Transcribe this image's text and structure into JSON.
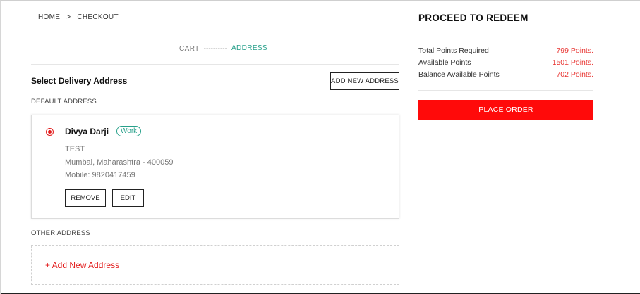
{
  "breadcrumb": {
    "home": "HOME",
    "separator": ">",
    "current": "CHECKOUT"
  },
  "steps": {
    "cart": "CART",
    "dashes": "----------",
    "address": "ADDRESS"
  },
  "address_section": {
    "title": "Select Delivery Address",
    "add_button": "ADD NEW ADDRESS",
    "default_label": "DEFAULT ADDRESS",
    "other_label": "OTHER ADDRESS",
    "add_link": "+ Add New Address"
  },
  "default_address": {
    "selected": true,
    "name": "Divya Darji",
    "tag": "Work",
    "line1": "TEST",
    "line2": "Mumbai, Maharashtra - 400059",
    "mobile": "Mobile: 9820417459",
    "remove_label": "REMOVE",
    "edit_label": "EDIT"
  },
  "summary": {
    "title": "PROCEED TO REDEEM",
    "rows": [
      {
        "label": "Total Points Required",
        "value": "799 Points."
      },
      {
        "label": "Available Points",
        "value": "1501 Points."
      },
      {
        "label": "Balance Available Points",
        "value": "702 Points."
      }
    ],
    "place_order": "PLACE ORDER"
  },
  "colors": {
    "accent_red": "#ff0a0a",
    "points_red": "#e8322f",
    "teal": "#27a08a"
  },
  "icons": {
    "breadcrumb_separator": "chevron-right-icon",
    "radio": "radio-selected-icon"
  }
}
